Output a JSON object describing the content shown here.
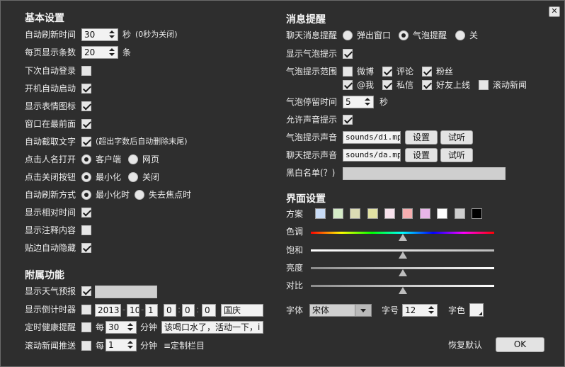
{
  "window": {
    "close_glyph": "✕"
  },
  "basic": {
    "title": "基本设置",
    "refresh_time": {
      "label": "自动刷新时间",
      "value": "30",
      "unit": "秒",
      "hint": "(0秒为关闭)"
    },
    "per_page": {
      "label": "每页显示条数",
      "value": "20",
      "unit": "条"
    },
    "auto_login": {
      "label": "下次自动登录",
      "checked": false
    },
    "startup": {
      "label": "开机自动启动",
      "checked": true
    },
    "emoticons": {
      "label": "显示表情图标",
      "checked": true
    },
    "topmost": {
      "label": "窗口在最前面",
      "checked": true
    },
    "truncate": {
      "label": "自动截取文字",
      "checked": true,
      "hint": "(超出字数后自动删除末尾)"
    },
    "click_name": {
      "label": "点击人名打开",
      "options": [
        "客户端",
        "网页"
      ],
      "selected": 0
    },
    "click_close": {
      "label": "点击关闭按钮",
      "options": [
        "最小化",
        "关闭"
      ],
      "selected": 0
    },
    "refresh_mode": {
      "label": "自动刷新方式",
      "options": [
        "最小化时",
        "失去焦点时"
      ],
      "selected": 0
    },
    "relative_time": {
      "label": "显示相对时间",
      "checked": true
    },
    "comments": {
      "label": "显示注释内容",
      "checked": false
    },
    "edge_hide": {
      "label": "贴边自动隐藏",
      "checked": true
    }
  },
  "extra": {
    "title": "附属功能",
    "weather": {
      "label": "显示天气预报",
      "checked": true,
      "value": ""
    },
    "countdown": {
      "label": "显示倒计时器",
      "checked": false,
      "year": "2013",
      "month": "10",
      "day": "1",
      "hour": "0",
      "minute": "0",
      "second": "0",
      "event": "国庆"
    },
    "health": {
      "label": "定时健康提醒",
      "checked": false,
      "every": "每",
      "value": "30",
      "unit": "分钟",
      "message": "该喝口水了，活动一下，i"
    },
    "news": {
      "label": "滚动新闻推送",
      "checked": false,
      "every": "每",
      "value": "1",
      "unit": "分钟",
      "link": "≡定制栏目"
    }
  },
  "notify": {
    "title": "消息提醒",
    "chat": {
      "label": "聊天消息提醒",
      "options": [
        "弹出窗口",
        "气泡提醒",
        "关"
      ],
      "selected": 1
    },
    "show_bubble": {
      "label": "显示气泡提示",
      "checked": true
    },
    "scope": {
      "label": "气泡提示范围",
      "items": [
        {
          "label": "微博",
          "checked": false
        },
        {
          "label": "评论",
          "checked": true
        },
        {
          "label": "粉丝",
          "checked": true
        },
        {
          "label": "@我",
          "checked": true
        },
        {
          "label": "私信",
          "checked": true
        },
        {
          "label": "好友上线",
          "checked": true
        },
        {
          "label": "滚动新闻",
          "checked": false
        }
      ]
    },
    "stay": {
      "label": "气泡停留时间",
      "value": "5",
      "unit": "秒"
    },
    "allow_sound": {
      "label": "允许声音提示",
      "checked": true
    },
    "bubble_sound": {
      "label": "气泡提示声音",
      "value": "sounds/di.mp3",
      "set": "设置",
      "listen": "试听"
    },
    "chat_sound": {
      "label": "聊天提示声音",
      "value": "sounds/da.mp3",
      "set": "设置",
      "listen": "试听"
    },
    "blacklist": {
      "label": "黑白名单(？)",
      "value": ""
    }
  },
  "ui": {
    "title": "界面设置",
    "scheme_label": "方案",
    "swatches": [
      "#c9dcf6",
      "#d6ecc8",
      "#dcdcb4",
      "#e2e2a4",
      "#f8e2ec",
      "#f6aeb0",
      "#e8b6e8",
      "#ffffff",
      "#cfcfcf",
      "#000000"
    ],
    "hue": {
      "label": "色调",
      "level": 0.5
    },
    "saturation": {
      "label": "饱和",
      "level": 0.5
    },
    "brightness": {
      "label": "亮度",
      "level": 0.5
    },
    "contrast": {
      "label": "对比",
      "level": 0.5
    },
    "font": {
      "label": "字体",
      "value": "宋体"
    },
    "size": {
      "label": "字号",
      "value": "12"
    },
    "color": {
      "label": "字色"
    }
  },
  "footer": {
    "restore": "恢复默认",
    "ok": "OK"
  }
}
